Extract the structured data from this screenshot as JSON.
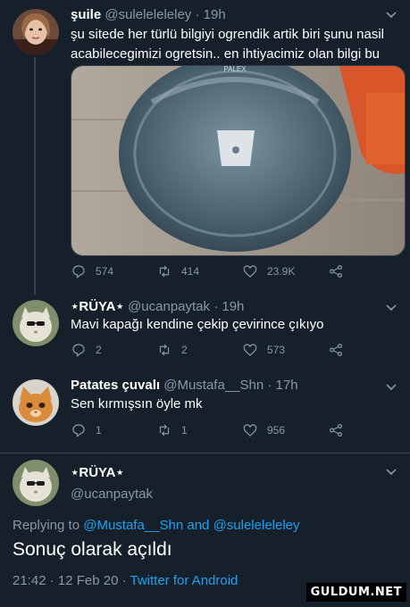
{
  "tweets": [
    {
      "name": "şuile",
      "handle": "@suleleleleleу",
      "time": "19h",
      "text": "şu sitede her türlü bilgiyi ogrendik artik biri şunu nasil acabilecegimizi ogretsin.. en ihtiyacimiz olan bilgi bu",
      "media_brand": "PALEX",
      "replies": "574",
      "retweets": "414",
      "likes": "23.9K"
    },
    {
      "name": "⋆RÜYA⋆",
      "handle": "@ucanpaytak",
      "time": "19h",
      "text": "Mavi kapağı kendine çekip çevirince çıkıyo",
      "replies": "2",
      "retweets": "2",
      "likes": "573"
    },
    {
      "name": "Patates çuvalı",
      "handle": "@Mustafa__Shn",
      "time": "17h",
      "text": "Sen kırmışsın öyle mk",
      "replies": "1",
      "retweets": "1",
      "likes": "956"
    }
  ],
  "focused": {
    "name": "⋆RÜYA⋆",
    "handle": "@ucanpaytak",
    "replying_prefix": "Replying to",
    "reply_user_1": "@Mustafa__Shn",
    "reply_and": "and",
    "reply_user_2": "@suleleleleleу",
    "text": "Sonuç olarak açıldı",
    "timestamp": "21:42 · 12 Feb 20 ·",
    "source": "Twitter for Android"
  },
  "watermark": "GULDUM.NET",
  "colors": {
    "background": "#15202b",
    "muted": "#8899a6",
    "link": "#1da1f2",
    "border": "#38444d"
  },
  "icons": [
    "reply-icon",
    "retweet-icon",
    "like-icon",
    "share-icon",
    "chevron-down-icon"
  ]
}
